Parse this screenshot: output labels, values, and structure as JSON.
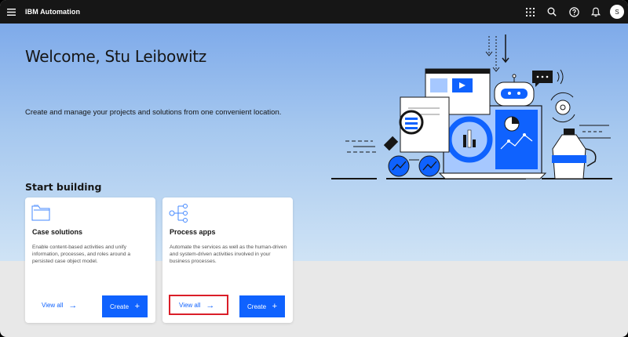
{
  "topbar": {
    "brand": "IBM Automation",
    "avatar_initial": "S",
    "icons": [
      "menu-icon",
      "app-switcher-icon",
      "search-icon",
      "help-icon",
      "notification-icon"
    ]
  },
  "hero": {
    "welcome": "Welcome, Stu Leibowitz",
    "subtitle": "Create and manage your projects and solutions from one convenient location."
  },
  "start_building": {
    "title": "Start building",
    "cards": [
      {
        "title": "Case solutions",
        "description": "Enable content-based activities and unify information, processes, and roles around a persisted case object model.",
        "view_all": "View all",
        "create": "Create",
        "icon": "folder-icon"
      },
      {
        "title": "Process apps",
        "description": "Automate the services as well as the human-driven and system-driven activities involved in your business processes.",
        "view_all": "View all",
        "create": "Create",
        "icon": "flow-icon"
      }
    ]
  },
  "colors": {
    "topbar": "#161616",
    "accent": "#0f62fe",
    "highlight": "#da1e28"
  }
}
